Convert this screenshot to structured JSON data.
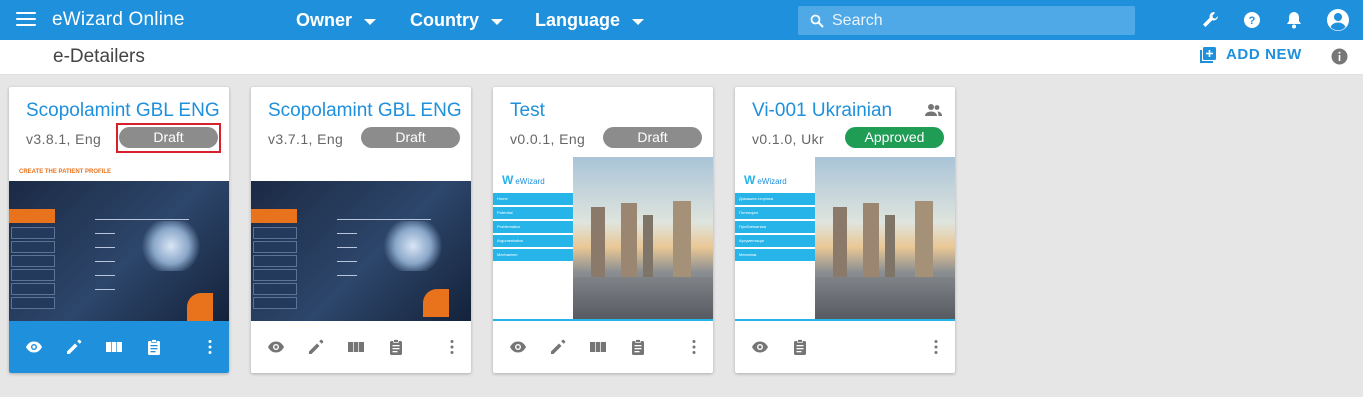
{
  "app": {
    "title": "eWizard Online",
    "filters": [
      "Owner",
      "Country",
      "Language"
    ],
    "search_placeholder": "Search",
    "accent_color": "#1e90dc"
  },
  "toolbar_icons": [
    "wrench-icon",
    "help-icon",
    "bell-icon",
    "account-icon"
  ],
  "page": {
    "title": "e-Detailers",
    "add_new_label": "ADD NEW"
  },
  "cards": [
    {
      "title": "Scopolamint GBL ENG",
      "version": "v3.8.1,  Eng",
      "status": "Draft",
      "status_color": "#8c8c8c",
      "highlighted": true,
      "thumbnail": "patient-profile-slide",
      "thumbnail_title": "CREATE THE PATIENT PROFILE",
      "actions": [
        "eye-icon",
        "pencil-icon",
        "book-icon",
        "clipboard-icon",
        "more-vert-icon"
      ]
    },
    {
      "title": "Scopolamint GBL ENG",
      "version": "v3.7.1,  Eng",
      "status": "Draft",
      "status_color": "#8c8c8c",
      "highlighted": false,
      "thumbnail": "patient-profile-slide",
      "actions": [
        "eye-icon",
        "pencil-icon",
        "book-icon",
        "clipboard-icon",
        "more-vert-icon"
      ]
    },
    {
      "title": "Test",
      "version": "v0.0.1,  Eng",
      "status": "Draft",
      "status_color": "#8c8c8c",
      "highlighted": false,
      "thumbnail": "ewizard-city-slide",
      "logo_text": "eWizard",
      "menu_items": [
        "Home",
        "Potential",
        "Problematics",
        "Argumentation",
        "Mechanism"
      ],
      "actions": [
        "eye-icon",
        "pencil-icon",
        "book-icon",
        "clipboard-icon",
        "more-vert-icon"
      ]
    },
    {
      "title": "Vi-001 Ukrainian",
      "version": "v0.1.0,  Ukr",
      "status": "Approved",
      "status_color": "#1f9d55",
      "highlighted": false,
      "shared": true,
      "thumbnail": "ewizard-city-slide",
      "logo_text": "eWizard",
      "menu_items": [
        "Домашня сторінка",
        "Потенціал",
        "Проблематика",
        "Аргументація",
        "Механізм"
      ],
      "actions": [
        "eye-icon",
        "clipboard-icon",
        "more-vert-icon"
      ]
    }
  ]
}
